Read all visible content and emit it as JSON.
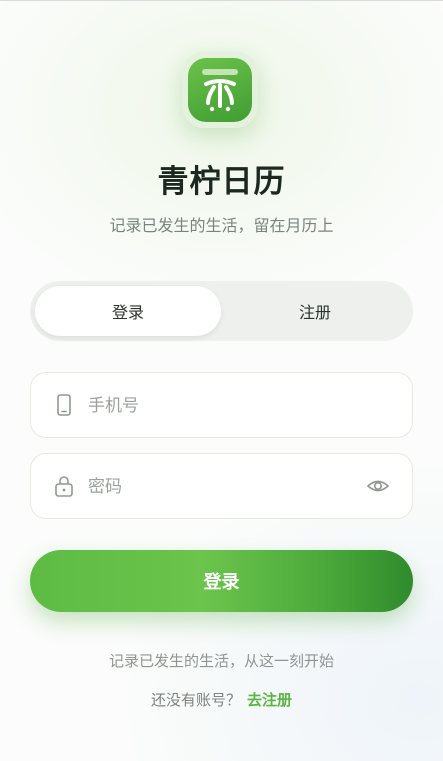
{
  "app": {
    "title": "青柠日历",
    "subtitle": "记录已发生的生活，留在月历上"
  },
  "tabs": [
    {
      "label": "登录",
      "active": true
    },
    {
      "label": "注册",
      "active": false
    }
  ],
  "form": {
    "phone": {
      "placeholder": "手机号",
      "value": "",
      "icon": "phone-icon"
    },
    "password": {
      "placeholder": "密码",
      "value": "",
      "icon": "lock-icon",
      "toggle_icon": "eye-icon"
    }
  },
  "login_button": {
    "label": "登录"
  },
  "footer": {
    "tagline": "记录已发生的生活，从这一刻开始",
    "no_account": "还没有账号？",
    "register_link": "去注册"
  },
  "colors": {
    "accent": "#5ab53f",
    "accent_dark": "#2f8b2c",
    "background": "#fbfcfb"
  }
}
